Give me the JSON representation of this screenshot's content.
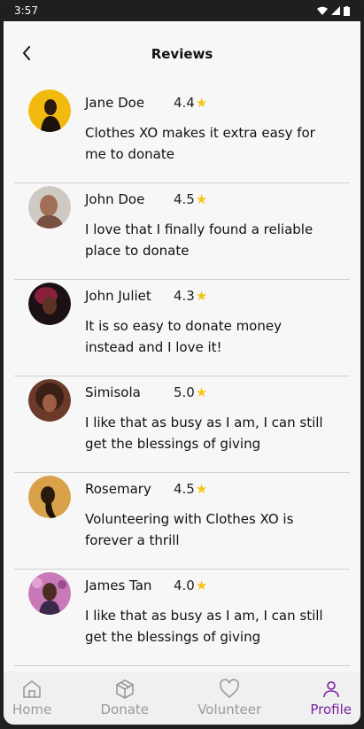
{
  "status_bar": {
    "time": "3:57"
  },
  "header": {
    "title": "Reviews"
  },
  "reviews": [
    {
      "name": "Jane Doe",
      "rating": "4.4",
      "text": "Clothes XO makes it extra easy for me to donate"
    },
    {
      "name": "John Doe",
      "rating": "4.5",
      "text": "I love that I finally found a reliable place to donate"
    },
    {
      "name": "John Juliet",
      "rating": "4.3",
      "text": "It is so easy to donate money instead and I love it!"
    },
    {
      "name": "Simisola",
      "rating": "5.0",
      "text": "I like that as busy as I am, I can still get the blessings of giving"
    },
    {
      "name": "Rosemary",
      "rating": "4.5",
      "text": "Volunteering with Clothes XO is forever a thrill"
    },
    {
      "name": "James Tan",
      "rating": "4.0",
      "text": "I like that as busy as I am, I can still get the blessings of giving"
    }
  ],
  "bottom_nav": [
    {
      "label": "Home",
      "icon": "home-icon"
    },
    {
      "label": "Donate",
      "icon": "box-icon"
    },
    {
      "label": "Volunteer",
      "icon": "heart-icon"
    },
    {
      "label": "Profile",
      "icon": "person-icon",
      "active": true
    }
  ],
  "colors": {
    "accent": "#7b1fa2",
    "star": "#f5c518"
  }
}
